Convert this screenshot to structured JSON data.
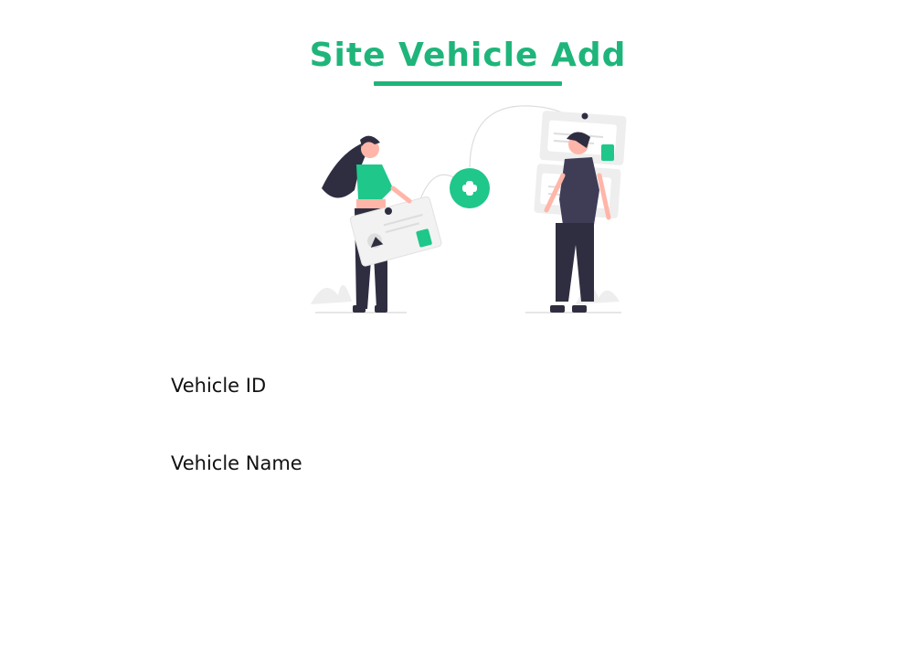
{
  "page": {
    "title": "Site Vehicle Add",
    "accent_color": "#1fb57a",
    "illustration_icon": "add-circle-icon"
  },
  "form": {
    "vehicle_id_label": "Vehicle ID",
    "vehicle_name_label": "Vehicle Name"
  }
}
